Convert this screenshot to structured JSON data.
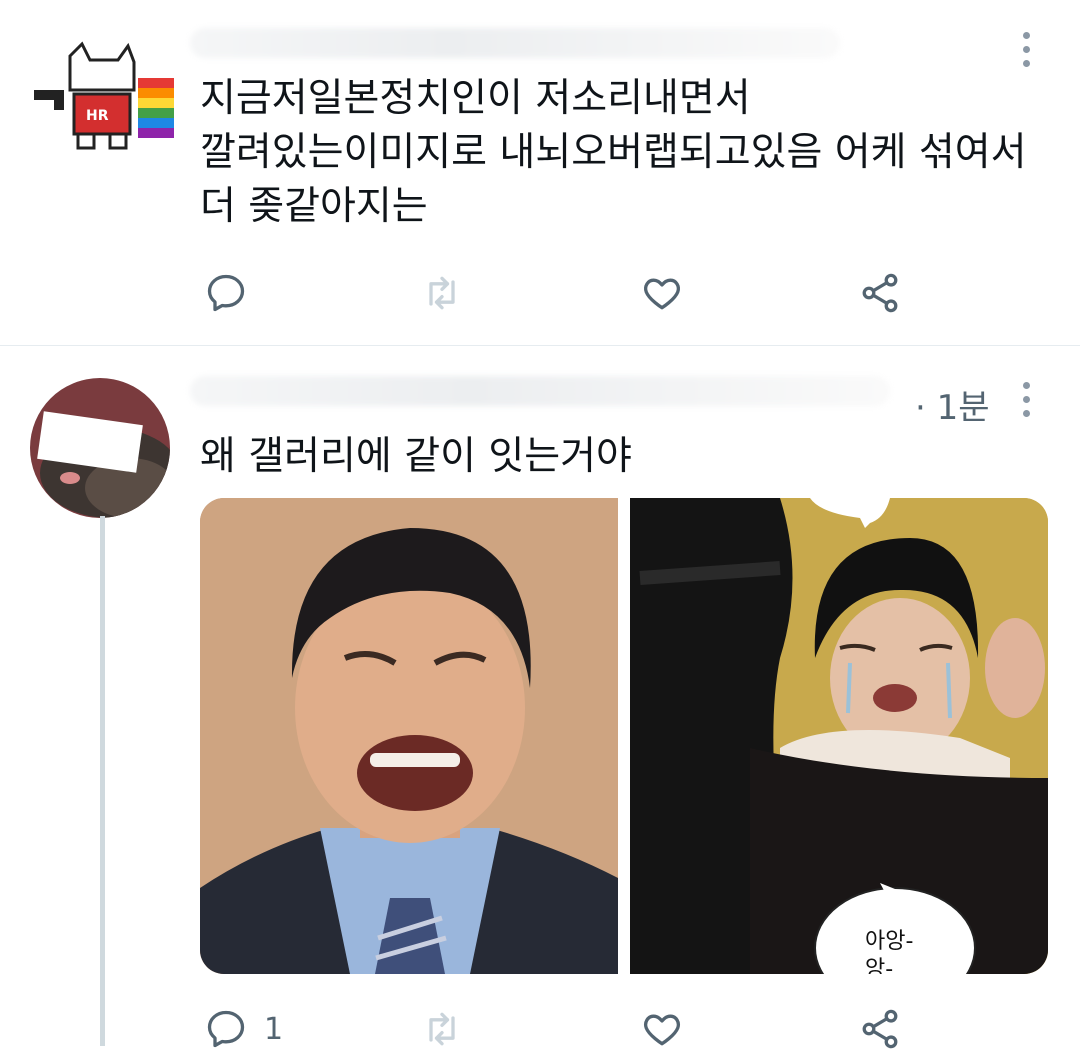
{
  "tweet1": {
    "name": "",
    "handle": "",
    "text_lines": [
      "지금저일본정치인이 저소리내면서",
      "깔려있는이미지로 내뇌오버랩되고있음 어케 섞여서",
      "더 좆같아지는"
    ],
    "actions": {
      "reply_icon": "reply-icon",
      "retweet_icon": "retweet-icon",
      "like_icon": "like-icon",
      "share_icon": "share-icon"
    }
  },
  "tweet2": {
    "name": "",
    "time": "· 1분",
    "text": "왜 갤러리에 같이 잇는거야",
    "media": {
      "left_image": "crying-politician-photo",
      "right_image": "crying-webtoon-panel",
      "bubble_text_1": "아앙-",
      "bubble_text_2": "앙-"
    },
    "actions": {
      "reply_count": "1"
    }
  },
  "colors": {
    "icon": "#536471",
    "text": "#0f1419",
    "divider": "#e6ecf0",
    "thread_line": "#cfd9de"
  }
}
